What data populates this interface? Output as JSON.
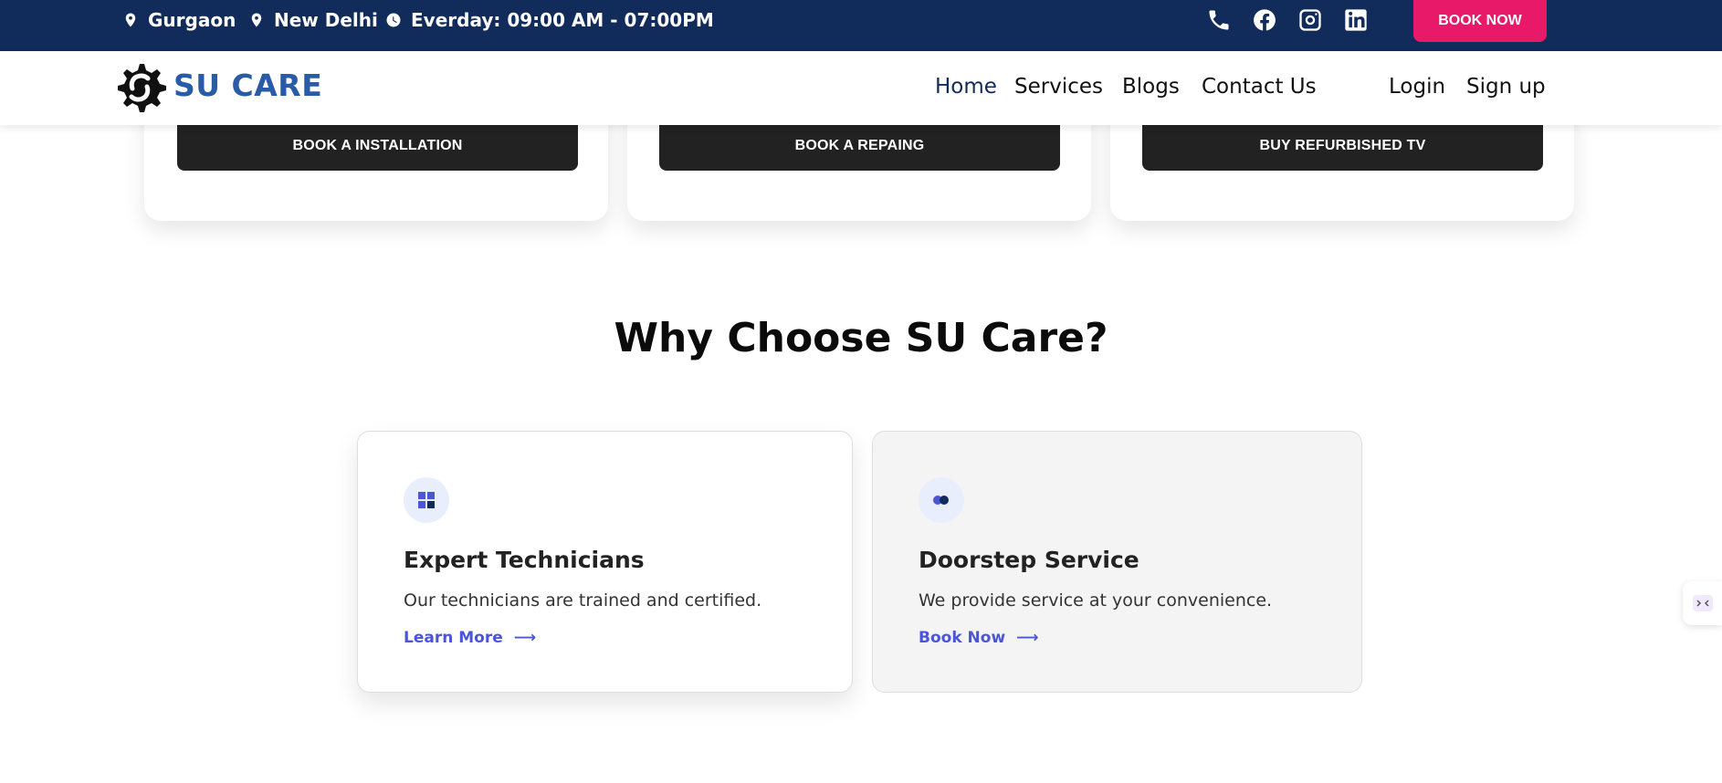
{
  "topbar": {
    "location1": "Gurgaon",
    "location2": "New Delhi",
    "hours": "Everday: 09:00 AM - 07:00PM",
    "book_now": "BOOK NOW",
    "social_icons": [
      "phone-icon",
      "facebook-icon",
      "instagram-icon",
      "linkedin-icon"
    ]
  },
  "services": {
    "buttons": [
      "BOOK A INSTALLATION",
      "BOOK A REPAING",
      "BUY REFURBISHED TV"
    ]
  },
  "header": {
    "logo_text": "SU CARE",
    "nav": [
      "Home",
      "Services",
      "Blogs",
      "Contact Us"
    ],
    "login": "Login",
    "signup": "Sign up"
  },
  "why": {
    "title": "Why Choose SU Care?",
    "cards": [
      {
        "icon": "grid-icon",
        "title": "Expert Technicians",
        "description": "Our technicians are trained and certified.",
        "link": "Learn More"
      },
      {
        "icon": "toggle-icon",
        "title": "Doorstep Service",
        "description": "We provide service at your convenience.",
        "link": "Book Now"
      }
    ]
  },
  "colors": {
    "topbar_bg": "#112b5b",
    "book_now_bg": "#e9196a",
    "logo_blue": "#2a5ba6",
    "link_blue": "#4a55d8",
    "button_dark": "#222222"
  }
}
